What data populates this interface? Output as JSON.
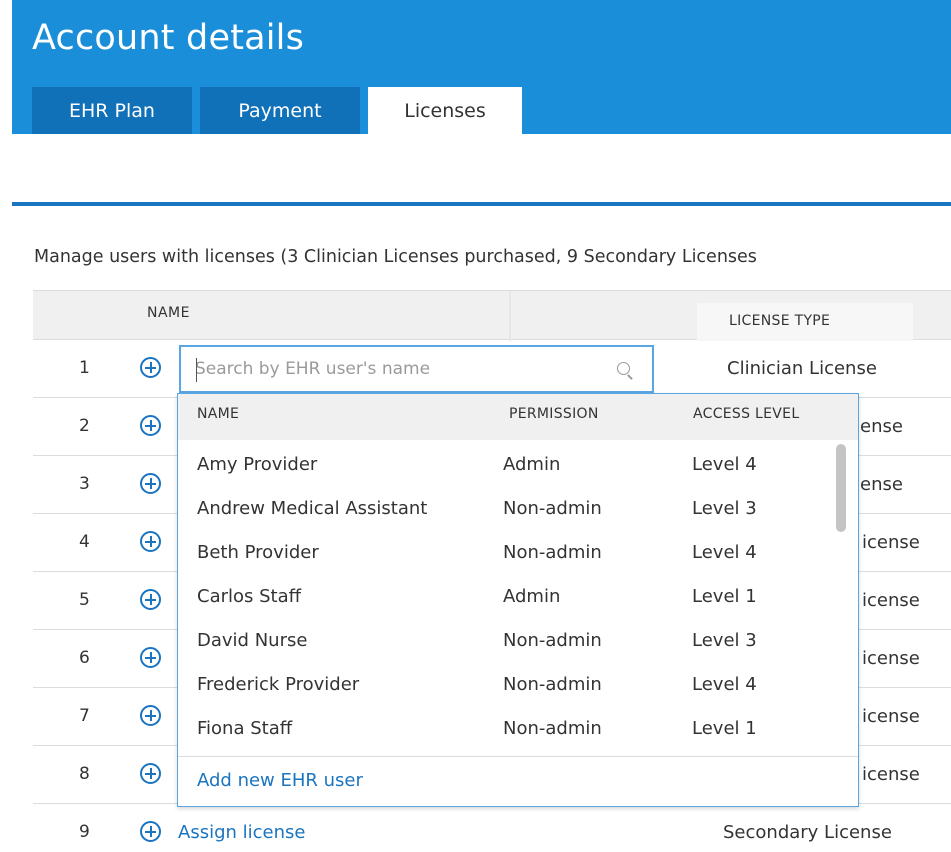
{
  "header": {
    "title": "Account details",
    "tabs": [
      "EHR Plan",
      "Payment",
      "Licenses"
    ],
    "active_tab": "Licenses",
    "colors": {
      "header_bg": "#1a8ed9",
      "tab_inactive": "#1070b8",
      "link": "#1a74bf"
    }
  },
  "main": {
    "manage_text": "Manage users with licenses (3 Clinician Licenses purchased, 9 Secondary Licenses"
  },
  "table": {
    "columns": [
      "NAME",
      "LICENSE TYPE"
    ],
    "rows": [
      {
        "num": "1",
        "license": "Clinician License"
      },
      {
        "num": "2",
        "license": "ense"
      },
      {
        "num": "3",
        "license": "ense"
      },
      {
        "num": "4",
        "license": "icense"
      },
      {
        "num": "5",
        "license": "icense"
      },
      {
        "num": "6",
        "license": "icense"
      },
      {
        "num": "7",
        "license": "icense"
      },
      {
        "num": "8",
        "license": "icense"
      },
      {
        "num": "9",
        "license": "Secondary License",
        "assign": "Assign license"
      }
    ]
  },
  "search": {
    "placeholder": "Search by EHR user's name",
    "value": ""
  },
  "dropdown": {
    "columns": [
      "NAME",
      "PERMISSION",
      "ACCESS LEVEL"
    ],
    "users": [
      {
        "name": "Amy Provider",
        "permission": "Admin",
        "access": "Level 4"
      },
      {
        "name": "Andrew Medical Assistant",
        "permission": "Non-admin",
        "access": "Level 3"
      },
      {
        "name": "Beth Provider",
        "permission": "Non-admin",
        "access": "Level 4"
      },
      {
        "name": "Carlos Staff",
        "permission": "Admin",
        "access": "Level 1"
      },
      {
        "name": "David Nurse",
        "permission": "Non-admin",
        "access": "Level 3"
      },
      {
        "name": "Frederick Provider",
        "permission": "Non-admin",
        "access": "Level 4"
      },
      {
        "name": "Fiona Staff",
        "permission": "Non-admin",
        "access": "Level 1"
      }
    ],
    "add_label": "Add new EHR user"
  }
}
